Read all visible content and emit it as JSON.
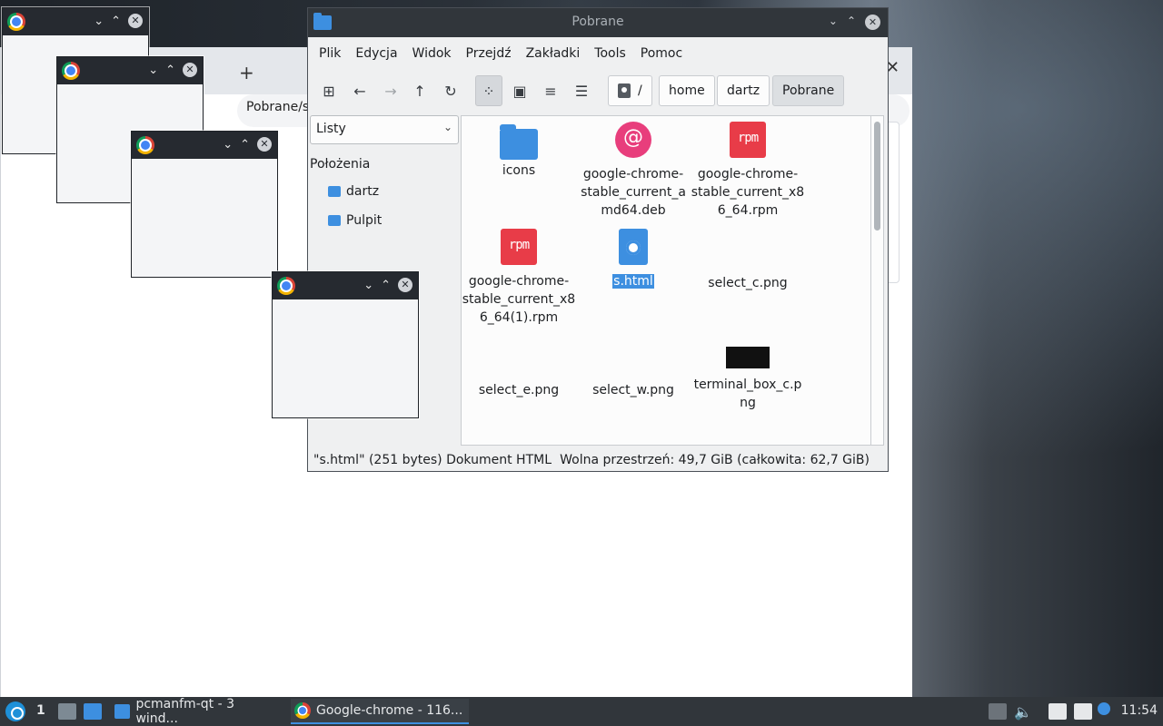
{
  "chrome_window": {
    "address_fragment": "Pobrane/s"
  },
  "file_manager": {
    "title": "Pobrane",
    "menu": [
      "Plik",
      "Edycja",
      "Widok",
      "Przejdź",
      "Zakładki",
      "Tools",
      "Pomoc"
    ],
    "toolbar_icons": [
      "new-tab-icon",
      "back-icon",
      "forward-icon",
      "up-icon",
      "reload-icon",
      "icon-view-icon",
      "thumbnail-view-icon",
      "compact-view-icon",
      "detailed-list-icon"
    ],
    "breadcrumbs": [
      "/",
      "home",
      "dartz",
      "Pobrane"
    ],
    "side_pane": {
      "mode": "Listy",
      "heading": "Położenia",
      "items": [
        "dartz",
        "Pulpit"
      ]
    },
    "files": [
      {
        "name": "icons",
        "icon": "folder-icon"
      },
      {
        "name": "google-chrome-stable_current_amd64.deb",
        "icon": "debian-package-icon"
      },
      {
        "name": "google-chrome-stable_current_x86_64.rpm",
        "icon": "rpm-package-icon"
      },
      {
        "name": "google-chrome-stable_current_x86_64(1).rpm",
        "icon": "rpm-package-icon"
      },
      {
        "name": "s.html",
        "icon": "html-file-icon",
        "selected": true
      },
      {
        "name": "select_c.png",
        "icon": "image-icon"
      },
      {
        "name": "select_e.png",
        "icon": "image-icon"
      },
      {
        "name": "select_w.png",
        "icon": "image-icon"
      },
      {
        "name": "terminal_box_c.png",
        "icon": "image-icon"
      }
    ],
    "status_left": "\"s.html\" (251 bytes) Dokument HTML",
    "status_right": "Wolna przestrzeń: 49,7 GiB (całkowita: 62,7 GiB)"
  },
  "taskbar": {
    "desktop_number": "1",
    "tasks": [
      {
        "label": "pcmanfm-qt - 3 wind...",
        "active": false
      },
      {
        "label": "Google-chrome - 116...",
        "active": true
      }
    ],
    "clock": "11:54"
  },
  "colors": {
    "accent": "#3d8fe0",
    "titlebar": "#31363b",
    "rpm_red": "#e83c48",
    "debian_pink": "#e83e7c"
  }
}
